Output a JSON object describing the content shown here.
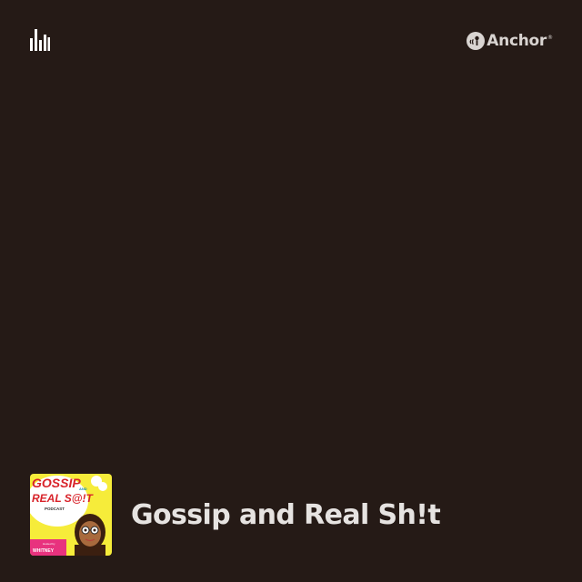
{
  "header": {
    "menu_icon": "audio-bars-icon",
    "brand": {
      "logo_icon": "anchor-logo-icon",
      "name": "Anchor",
      "reg_mark": "®"
    }
  },
  "episode": {
    "cover": {
      "icon": "podcast-cover-art",
      "title_line1": "GOSSIP",
      "title_and": "AND",
      "title_line2": "REAL S@!T",
      "subtitle": "PODCAST",
      "host_label": "Hosted by",
      "host_name": "WHITNEY"
    },
    "title": "Gossip and Real Sh!t"
  },
  "colors": {
    "background": "#251a16",
    "text": "#e6e3e1",
    "brand_text": "#d9d4d1"
  }
}
